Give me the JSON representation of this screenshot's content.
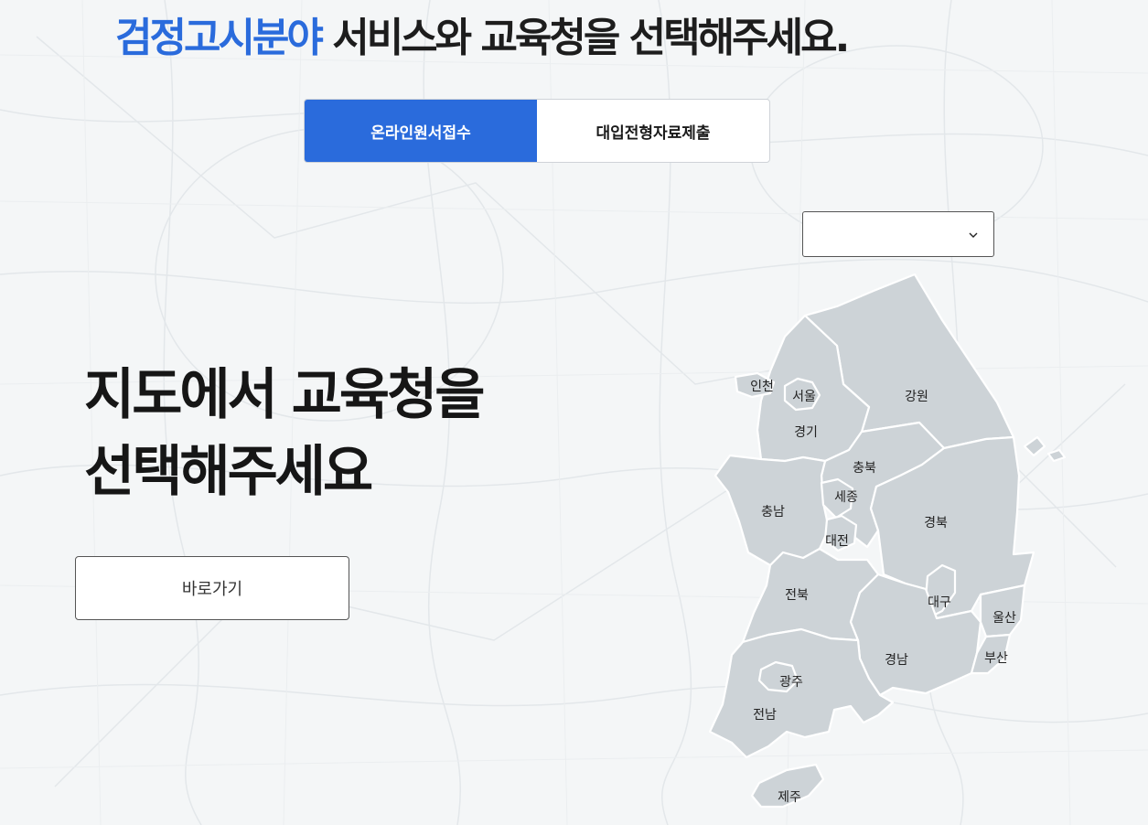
{
  "headline": {
    "accent": "검정고시분야",
    "rest": " 서비스와 교육청을 선택해주세요."
  },
  "tabs": [
    {
      "label": "온라인원서접수",
      "active": true
    },
    {
      "label": "대입전형자료제출",
      "active": false
    }
  ],
  "region_select": {
    "value": "",
    "icon": "chevron-down-icon"
  },
  "map_title": {
    "line1": "지도에서 교육청을",
    "line2": "선택해주세요"
  },
  "goto_button": {
    "label": "바로가기"
  },
  "regions": {
    "incheon": "인천",
    "seoul": "서울",
    "gyeonggi": "경기",
    "gangwon": "강원",
    "chungbuk": "충북",
    "sejong": "세종",
    "chungnam": "충남",
    "daejeon": "대전",
    "gyeongbuk": "경북",
    "jeonbuk": "전북",
    "daegu": "대구",
    "ulsan": "울산",
    "gyeongnam": "경남",
    "busan": "부산",
    "gwangju": "광주",
    "jeonnam": "전남",
    "jeju": "제주"
  },
  "colors": {
    "accent": "#2a6bdc",
    "region_fill": "#cdd3d7",
    "background": "#f4f6f7"
  }
}
